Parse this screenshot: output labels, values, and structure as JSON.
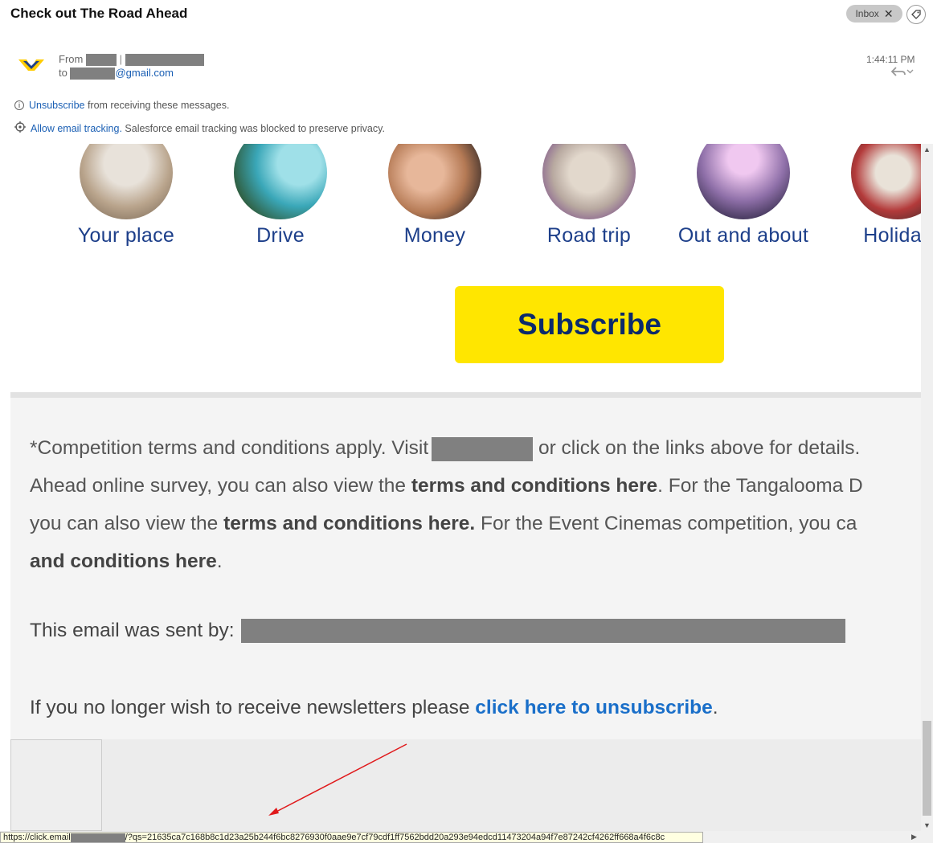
{
  "header": {
    "subject": "Check out The Road Ahead",
    "tag_label": "Inbox",
    "tag_close": "✕",
    "from_label": "From",
    "to_label": "to",
    "to_domain": "@gmail.com",
    "time": "1:44:11 PM"
  },
  "notices": {
    "unsubscribe_link": "Unsubscribe",
    "unsubscribe_text": " from receiving these messages.",
    "tracking_link": "Allow email tracking.",
    "tracking_text": " Salesforce email tracking was blocked to preserve privacy."
  },
  "categories": [
    {
      "label": "Your place",
      "color": "#b9a48c"
    },
    {
      "label": "Drive",
      "color": "#3aa7b8"
    },
    {
      "label": "Money",
      "color": "#b57a55"
    },
    {
      "label": "Road trip",
      "color": "#b8a9a0"
    },
    {
      "label": "Out and about",
      "color": "#8e6fa8"
    },
    {
      "label": "Holiday",
      "color": "#b33a3a"
    }
  ],
  "subscribe_button": "Subscribe",
  "footer": {
    "terms_l1_a": "*Competition terms and conditions apply. Visit",
    "terms_l1_b": " or click on the links above for details. ",
    "terms_l2_a": "Ahead online survey, you can also view the ",
    "terms_l2_b": "terms and conditions here",
    "terms_l2_c": ". For the Tangalooma D",
    "terms_l3_a": "you can also view the ",
    "terms_l3_b": "terms and conditions here.",
    "terms_l3_c": " For the Event Cinemas competition, you ca",
    "terms_l4_a": "and conditions here",
    "terms_l4_b": ".",
    "sent_by": "This email was sent by:",
    "unsub_a": "If you no longer wish to receive newsletters please ",
    "unsub_link": "click here to unsubscribe",
    "unsub_b": "."
  },
  "status_bar": {
    "url_prefix": "https://click.email",
    "url_suffix": "/?qs=21635ca7c168b8c1d23a25b244f6bc8276930f0aae9e7cf79cdf1ff7562bdd20a293e94edcd11473204a94f7e87242cf4262ff668a4f6c8c"
  },
  "icons": {
    "tag": "tag-icon",
    "reply": "reply-icon",
    "info": "info-icon",
    "tracking": "tracking-icon"
  },
  "colors": {
    "accent_yellow": "#ffe600",
    "navy": "#0b2a6b",
    "link_blue": "#1a6fc9",
    "annotation_red": "#e0191b"
  }
}
